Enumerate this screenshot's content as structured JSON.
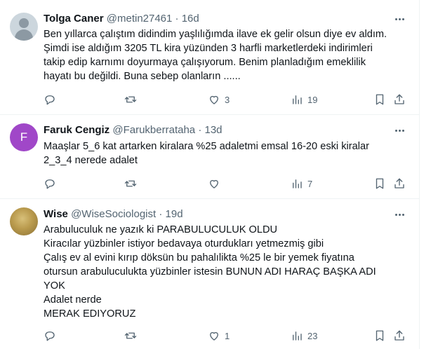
{
  "tweets": [
    {
      "name": "Tolga Caner",
      "handle": "@metin27461",
      "dot": "·",
      "time": "16d",
      "lines": [
        "Ben yıllarca çalıştım didindim yaşlılığımda ilave ek gelir olsun diye ev aldım.",
        "Şimdi ise aldığım 3205 TL kira yüzünden 3 harfli marketlerdeki indirimleri",
        "takip edip karnımı doyurmaya çalışıyorum. Benim planladığım emeklilik",
        "hayatı bu değildi. Buna sebep olanların ......"
      ],
      "replies": "",
      "retweets": "",
      "likes": "3",
      "views": "19"
    },
    {
      "avatar_letter": "F",
      "name": "Faruk Cengiz",
      "handle": "@Farukberrataha",
      "dot": "·",
      "time": "13d",
      "lines": [
        "Maaşlar 5_6 kat artarken kiralara %25 adaletmi emsal 16-20 eski kiralar",
        "2_3_4 nerede adalet"
      ],
      "replies": "",
      "retweets": "",
      "likes": "",
      "views": "7"
    },
    {
      "name": "Wise",
      "handle": "@WiseSociologist",
      "dot": "·",
      "time": "19d",
      "lines": [
        "Arabuluculuk ne yazık ki PARABULUCULUK OLDU",
        "Kiracılar yüzbinler istiyor bedavaya oturdukları yetmezmiş gibi",
        "Çalış ev al evini kırıp döksün bu pahalılikta %25 le bir yemek fiyatına",
        "otursun arabuluculukta yüzbinler istesin BUNUN ADI HARAÇ BAŞKA ADI",
        "YOK",
        "Adalet nerde",
        "MERAK EDIYORUZ"
      ],
      "replies": "",
      "retweets": "",
      "likes": "1",
      "views": "23"
    }
  ],
  "colors": {
    "text": "#0f1419",
    "secondary": "#536471",
    "divider": "#eff3f4",
    "avatar_letter_bg": "#a047c8"
  },
  "icons": [
    "reply-icon",
    "retweet-icon",
    "like-icon",
    "views-icon",
    "bookmark-icon",
    "share-icon",
    "more-icon"
  ]
}
